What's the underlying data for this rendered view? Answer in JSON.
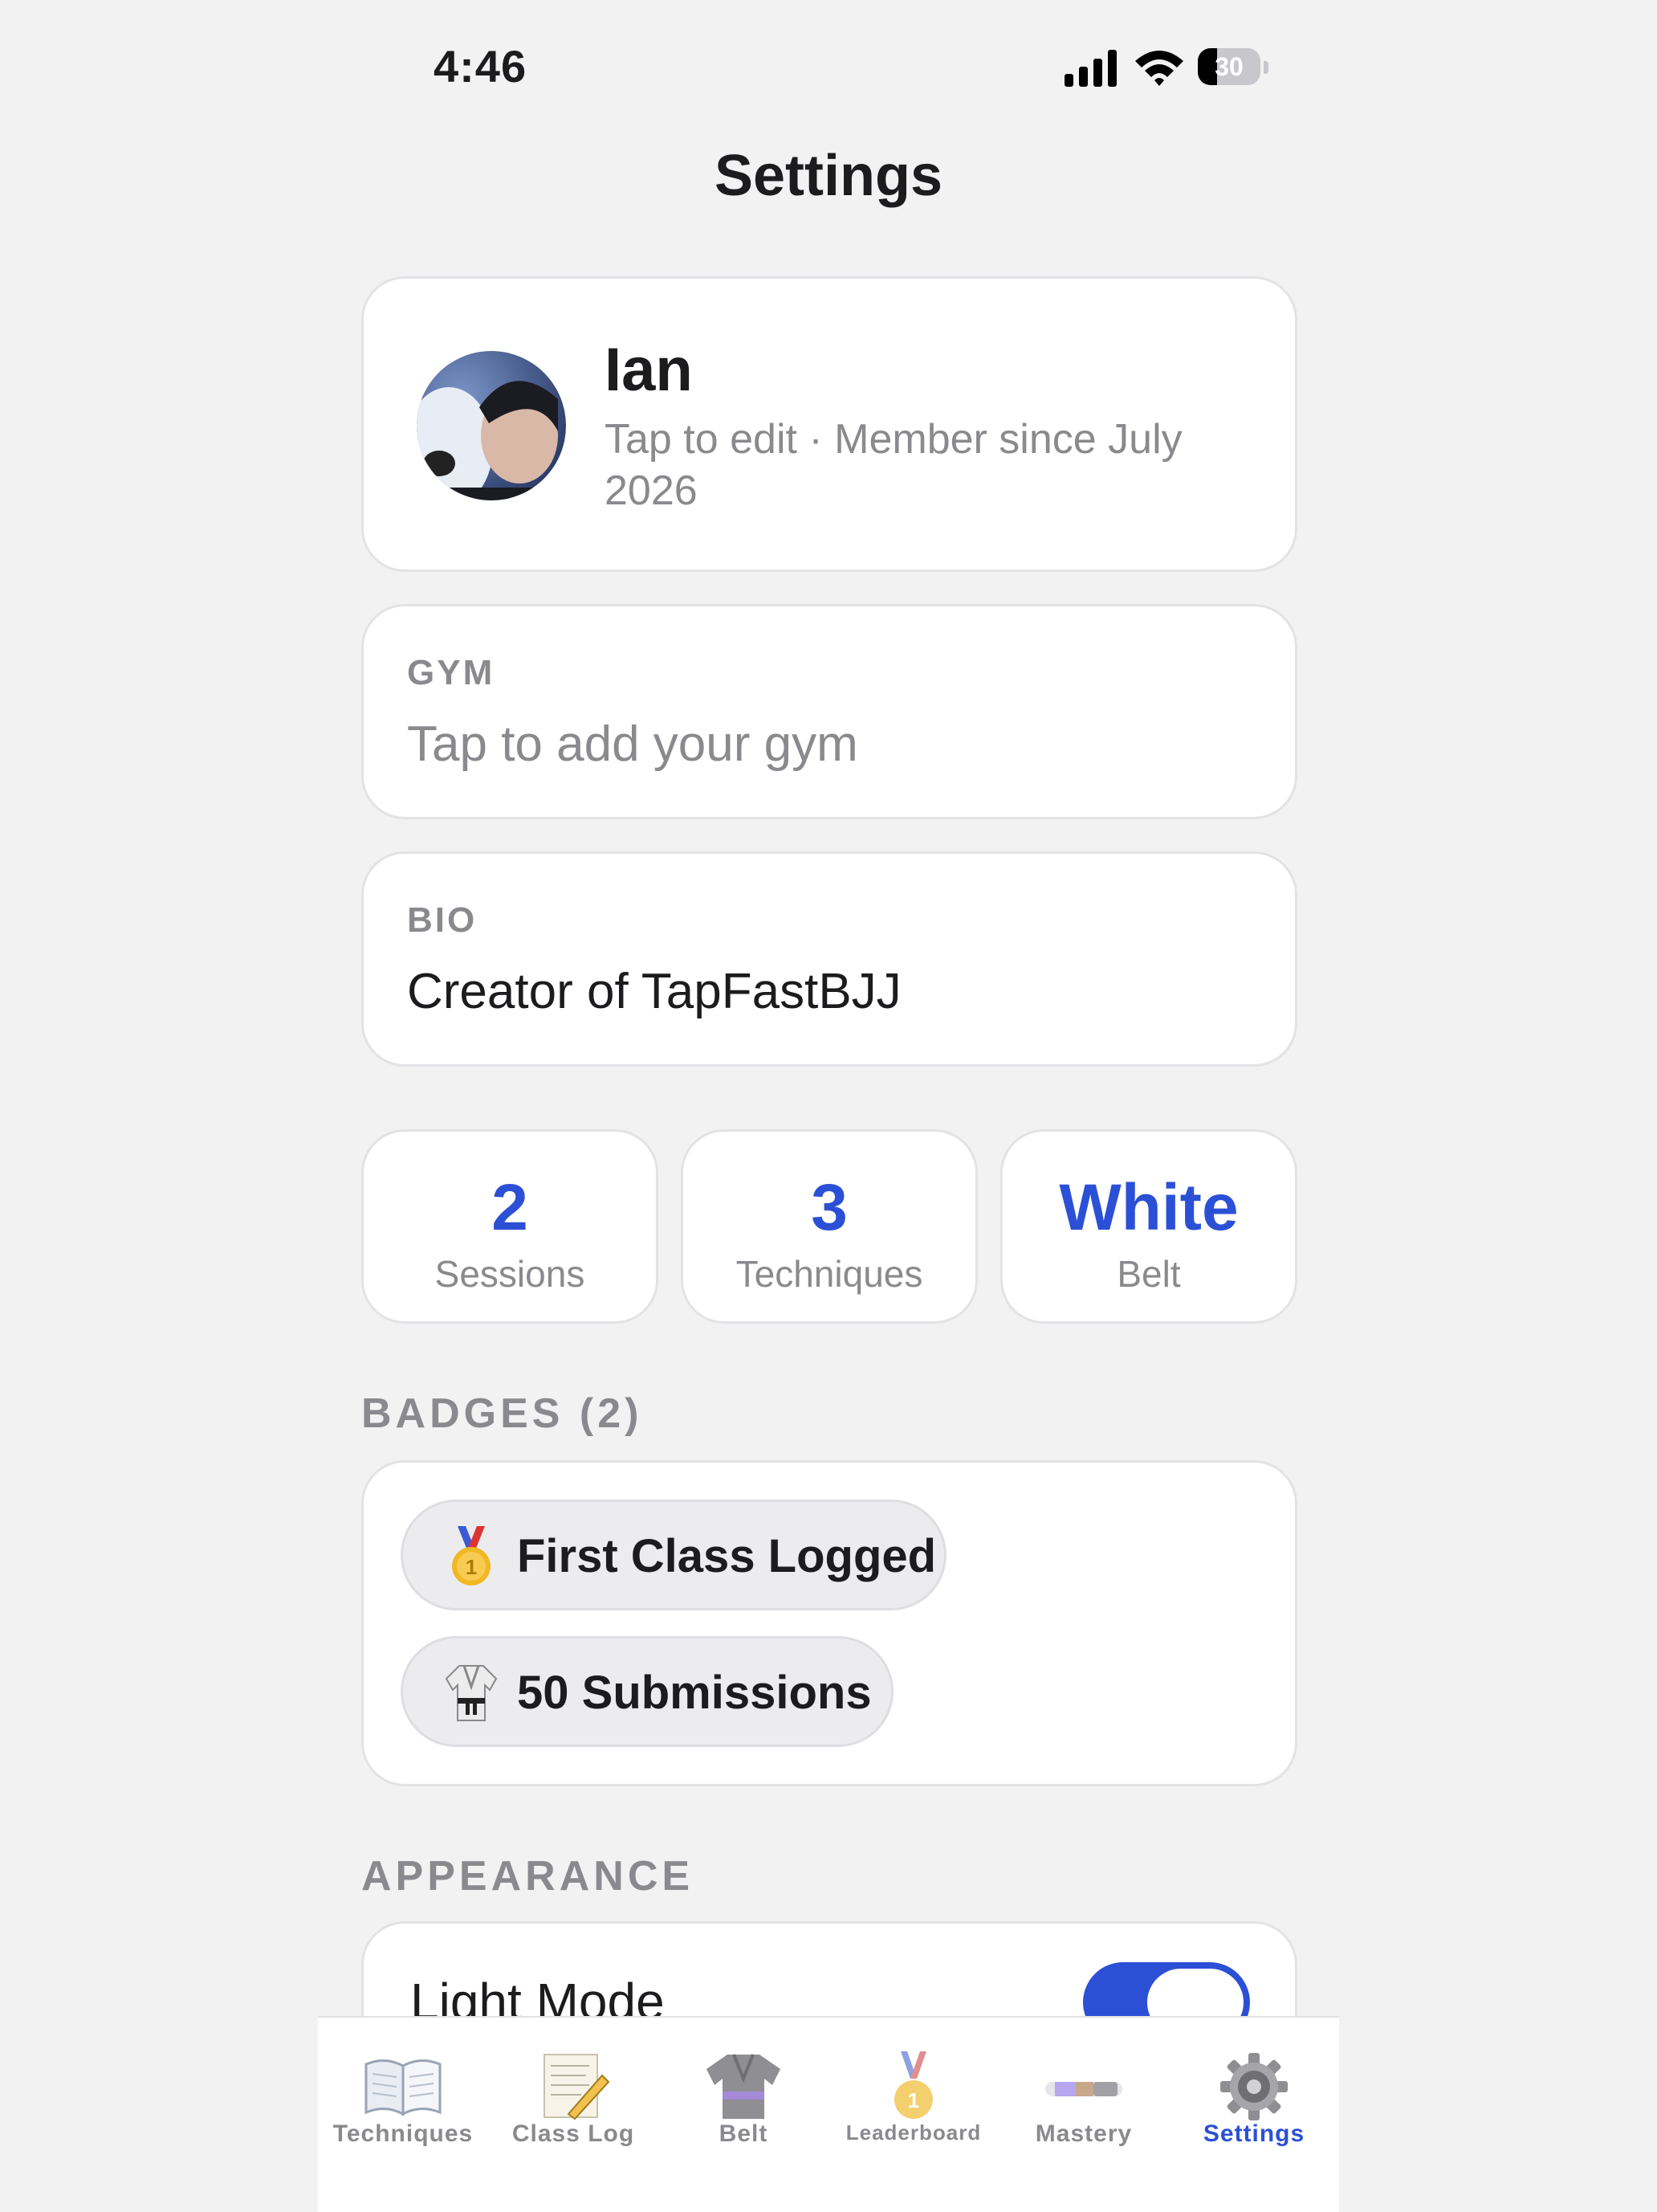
{
  "status_bar": {
    "time": "4:46",
    "battery": "30"
  },
  "page": {
    "title": "Settings"
  },
  "profile": {
    "name": "Ian",
    "subtitle": "Tap to edit · Member since July 2026"
  },
  "gym": {
    "label": "GYM",
    "value": "Tap to add your gym"
  },
  "bio": {
    "label": "BIO",
    "value": "Creator of TapFastBJJ"
  },
  "stats": [
    {
      "value": "2",
      "label": "Sessions"
    },
    {
      "value": "3",
      "label": "Techniques"
    },
    {
      "value": "White",
      "label": "Belt"
    }
  ],
  "badges": {
    "header": "BADGES (2)",
    "items": [
      {
        "icon": "medal-icon",
        "label": "First Class Logged"
      },
      {
        "icon": "gi-icon",
        "label": "50 Submissions"
      }
    ]
  },
  "appearance": {
    "header": "APPEARANCE",
    "light_mode_label": "Light Mode",
    "light_mode_on": true
  },
  "tabbar": {
    "tabs": [
      {
        "label": "Techniques",
        "icon": "book-icon"
      },
      {
        "label": "Class Log",
        "icon": "notepad-icon"
      },
      {
        "label": "Belt",
        "icon": "gi-icon"
      },
      {
        "label": "Leaderboard",
        "icon": "medal-icon"
      },
      {
        "label": "Mastery",
        "icon": "progress-bar-icon"
      },
      {
        "label": "Settings",
        "icon": "gear-icon"
      }
    ],
    "active": "Settings"
  },
  "colors": {
    "accent": "#2b50d6",
    "background": "#f2f2f2",
    "secondary_text": "#8a8a8e"
  }
}
